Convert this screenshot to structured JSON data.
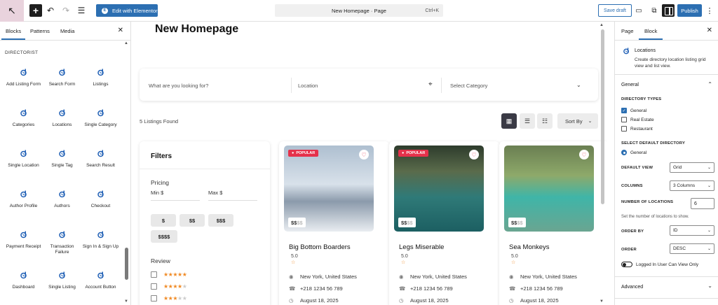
{
  "topbar": {
    "edit_elementor": "Edit with Elementor",
    "doc_title": "New Homepage · Page",
    "shortcut": "Ctrl+K",
    "save_draft": "Save draft",
    "publish": "Publish",
    "icons": [
      "wordpress-back-icon",
      "plus-icon",
      "undo-icon",
      "redo-icon",
      "list-view-icon",
      "desktop-view-icon",
      "preview-icon",
      "settings-icon",
      "more-icon"
    ]
  },
  "left_sidebar": {
    "tabs": [
      "Blocks",
      "Patterns",
      "Media"
    ],
    "section": "DIRECTORIST",
    "blocks": [
      "Add Listing Form",
      "Search Form",
      "Listings",
      "Categories",
      "Locations",
      "Single Category",
      "Single Location",
      "Single Tag",
      "Search Result",
      "Author Profile",
      "Authors",
      "Checkout",
      "Payment Receipt",
      "Transaction Failure",
      "Sign In & Sign Up",
      "Dashboard",
      "Single Listing",
      "Account Button"
    ]
  },
  "canvas": {
    "page_title": "New Homepage",
    "search": {
      "keyword_placeholder": "What are you looking for?",
      "location_placeholder": "Location",
      "category_placeholder": "Select Category"
    },
    "listings_found": "5 Listings Found",
    "sort_by": "Sort By",
    "filters": {
      "title": "Filters",
      "pricing": "Pricing",
      "min": "Min $",
      "max": "Max $",
      "price_levels": [
        "$",
        "$$",
        "$$$",
        "$$$$"
      ],
      "review": "Review",
      "review_rows": [
        5,
        4,
        3
      ]
    },
    "cards": [
      {
        "title": "Big Bottom Boarders",
        "badge": "POPULAR",
        "price_on": "$$",
        "price_off": "$$",
        "rating": "5.0",
        "location": "New York, United States",
        "phone": "+218 1234 56 789",
        "date": "August 18, 2025"
      },
      {
        "title": "Legs Miserable",
        "badge": "POPULAR",
        "price_on": "$$",
        "price_off": "$$",
        "rating": "5.0",
        "location": "New York, United States",
        "phone": "+218 1234 56 789",
        "date": "August 18, 2025"
      },
      {
        "title": "Sea Monkeys",
        "badge": "",
        "price_on": "$$",
        "price_off": "$$",
        "rating": "5.0",
        "location": "New York, United States",
        "phone": "+218 1234 56 789",
        "date": "August 18, 2025"
      }
    ]
  },
  "right_sidebar": {
    "tabs": [
      "Page",
      "Block"
    ],
    "block_title": "Locations",
    "block_desc": "Create directory location listing grid view and list view.",
    "general": "General",
    "directory_types_label": "DIRECTORY TYPES",
    "directory_types": [
      {
        "label": "General",
        "checked": true
      },
      {
        "label": "Real Estate",
        "checked": false
      },
      {
        "label": "Restaurant",
        "checked": false
      }
    ],
    "select_default_label": "SELECT DEFAULT DIRECTORY",
    "default_directory": "General",
    "default_view_label": "DEFAULT VIEW",
    "default_view": "Grid",
    "columns_label": "COLUMNS",
    "columns": "3 Columns",
    "num_locations_label": "NUMBER OF LOCATIONS",
    "num_locations": "6",
    "num_help": "Set the number of locations to show.",
    "order_by_label": "ORDER BY",
    "order_by": "ID",
    "order_label": "ORDER",
    "order": "DESC",
    "logged_in_label": "Logged In User Can View Only",
    "advanced": "Advanced"
  },
  "colors": {
    "accent": "#2c6fb2",
    "popular_badge": "#e5314b",
    "star": "#f08a24",
    "directorist_icon": "#1f5fb5"
  }
}
